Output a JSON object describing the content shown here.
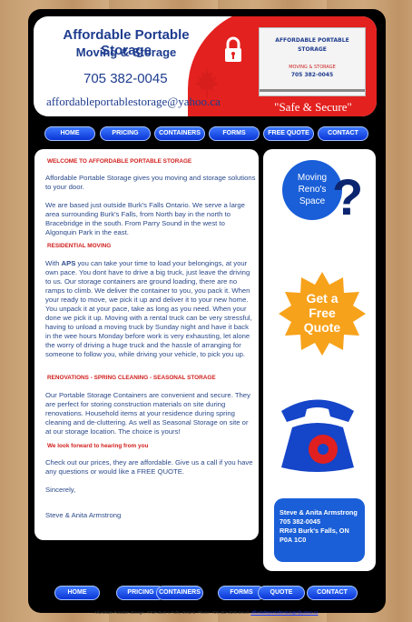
{
  "header": {
    "company_name": "Affordable Portable Storage",
    "tagline": "Moving & Storage",
    "phone": "705 382-0045",
    "email": "affordableportablestorage@yahoo.ca",
    "slogan": "\"Safe & Secure\"",
    "container_title": "AFFORDABLE PORTABLE",
    "container_sub": "STORAGE",
    "container_moving": "MOVING & STORAGE",
    "container_phone": "705 382-0045"
  },
  "nav_top": [
    "HOME",
    "PRICING",
    "CONTAINERS",
    "FORMS",
    "FREE QUOTE",
    "CONTACT"
  ],
  "nav_bottom": [
    "HOME",
    "PRICING",
    "CONTAINERS",
    "FORMS",
    "QUOTE",
    "CONTACT"
  ],
  "content": {
    "welcome_heading": "WELCOME TO AFFORDABLE PORTABLE STORAGE",
    "intro": "Affordable Portable Storage gives you moving and storage solutions to your door.",
    "location": "We are based just outside Burk's Falls Ontario. We serve a large area surrounding Burk's Falls, from North bay in the north to Bracebridge in the south. From Parry Sound in the west to Algonquin Park in the east.",
    "residential_heading": "RESIDENTIAL MOVING",
    "residential_bold": "APS",
    "residential_lead": "With ",
    "residential_text": " you can take your time to load your belongings, at your own pace. You dont have to drive a big truck, just leave the driving to us. Our storage containers are ground loading, there are no ramps to climb. We deliver the container to you, you pack it. When your ready to move, we pick it up and deliver it to your new home. You unpack it at your pace, take as long as you need. When your done we pick it up. Moving with a rental truck can be very stressful, having to unload a moving truck by Sunday night and have it back in the wee hours Monday before work is very exhausting, let alone the worry of driving a huge truck and the hassle of arranging for someone to follow you, while driving your vehicle, to pick you up.",
    "renovations_heading": "RENOVATIONS - SPRING CLEANING - SEASONAL STORAGE",
    "renovations_text": "Our Portable Storage Containers are convenient and secure. They are perfect for storing construction materials on site during renovations. Household items at your residence during spring cleaning and de-cluttering. As well as Seasonal Storage on site or at our storage location. The choice is yours!",
    "look_forward_heading": "We look forward to hearing from you",
    "closing": "Check out our prices, they are affordable. Give us a call if you have any questions or would like a FREE QUOTE.",
    "sincerely": "Sincerely,",
    "signature": "Steve & Anita Armstrong"
  },
  "sidebar": {
    "reno_line1": "Moving",
    "reno_line2": "Reno's",
    "reno_line3": "Space",
    "quote_line1": "Get a",
    "quote_line2": "Free",
    "quote_line3": "Quote",
    "contact_name": "Steve & Anita Armstrong",
    "contact_phone": "705 382-0045",
    "contact_address1": "RR#3 Burk's Falls, ON",
    "contact_address2": "P0A 1C0"
  },
  "footer": {
    "text": "Affordable Portable Storage, RR3# Burk`s Falls, Ontario. Phone: 705-382-0045 Email: ",
    "email": "affordableportablestorage@yahoo.ca"
  },
  "colors": {
    "brand_blue": "#1f3d8f",
    "brand_red": "#e3211f",
    "nav_blue": "#0b36d6",
    "quote_orange": "#f7a21b"
  }
}
